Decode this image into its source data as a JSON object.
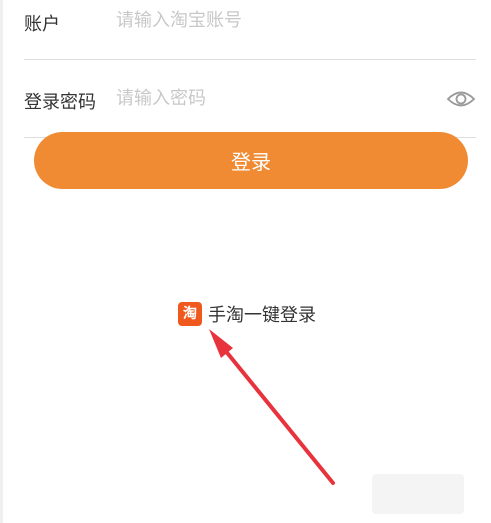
{
  "form": {
    "account_label": "账户",
    "account_placeholder": "请输入淘宝账号",
    "password_label": "登录密码",
    "password_placeholder": "请输入密码",
    "login_button_label": "登录"
  },
  "quick_login": {
    "icon_char": "淘",
    "label": "手淘一键登录"
  },
  "colors": {
    "accent": "#f08b33",
    "taobao_icon": "#f0591d",
    "arrow": "#e8323c",
    "placeholder": "#c8c8c8"
  },
  "icons": {
    "password_visibility": "eye-icon",
    "taobao": "taobao-app-icon",
    "annotation": "red-arrow-icon"
  }
}
